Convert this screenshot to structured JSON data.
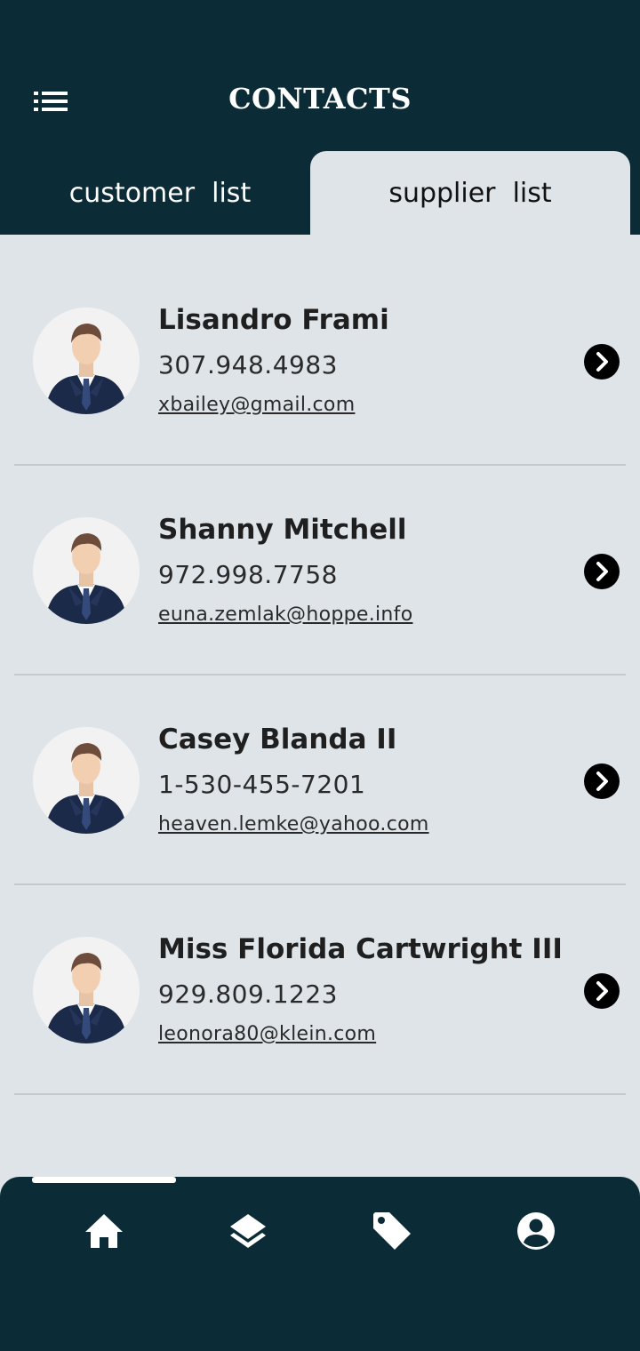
{
  "header": {
    "title": "CONTACTS",
    "menu_icon": "list-menu-icon"
  },
  "tabs": [
    {
      "label": "customer  list",
      "active": false
    },
    {
      "label": "supplier  list",
      "active": true
    }
  ],
  "contacts": [
    {
      "name": "Lisandro Frami",
      "phone": "307.948.4983",
      "email": "xbailey@gmail.com"
    },
    {
      "name": "Shanny Mitchell",
      "phone": "972.998.7758",
      "email": "euna.zemlak@hoppe.info"
    },
    {
      "name": "Casey Blanda II",
      "phone": "1-530-455-7201",
      "email": "heaven.lemke@yahoo.com"
    },
    {
      "name": "Miss Florida Cartwright III",
      "phone": "929.809.1223",
      "email": "leonora80@klein.com"
    }
  ],
  "bottom_nav": {
    "items": [
      "home-icon",
      "layers-icon",
      "tag-icon",
      "account-circle-icon"
    ],
    "active_index": 0
  },
  "colors": {
    "header_bg": "#0b2b36",
    "page_bg": "#dfe4e8",
    "chevron_bg": "#000000"
  }
}
